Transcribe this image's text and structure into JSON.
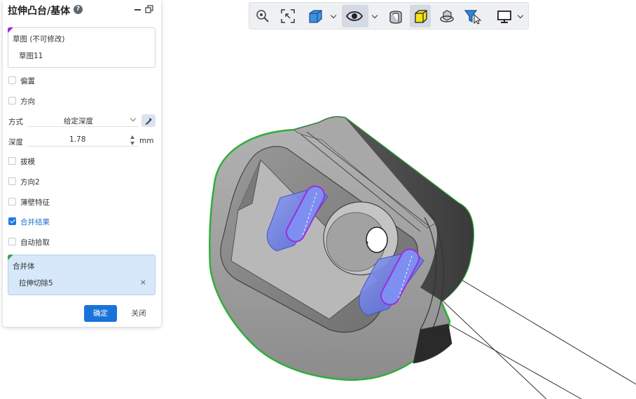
{
  "panel": {
    "title": "拉伸凸台/基体",
    "help_glyph": "?",
    "sketch_box": {
      "label": "草图 (不可修改)",
      "value": "草图11"
    },
    "offset_label": "偏置",
    "direction_label": "方向",
    "method": {
      "label": "方式",
      "value": "给定深度"
    },
    "depth": {
      "label": "深度",
      "value": "1.78",
      "unit": "mm"
    },
    "draft_label": "拔模",
    "direction2_label": "方向2",
    "thin_feature_label": "薄壁特征",
    "merge_result_label": "合并结果",
    "merge_result_checked": true,
    "auto_pick_label": "自动拾取",
    "merge_body_box": {
      "label": "合并体",
      "value": "拉伸切除5",
      "remove_glyph": "×"
    },
    "ok_label": "确定",
    "close_label": "关闭"
  },
  "toolbar": {
    "items": [
      "zoom-icon",
      "zoom-to-fit-icon",
      "view-orientation-icon",
      "visibility-icon",
      "section-view-icon",
      "shaded-display-icon",
      "rotate-view-icon",
      "filter-icon",
      "display-monitor-icon"
    ]
  },
  "colors": {
    "accent": "#1a73d9",
    "selection_outline": "#2fae3a",
    "sketch_marker": "#9b27d9",
    "feature_preview": "#5b6fe0"
  }
}
